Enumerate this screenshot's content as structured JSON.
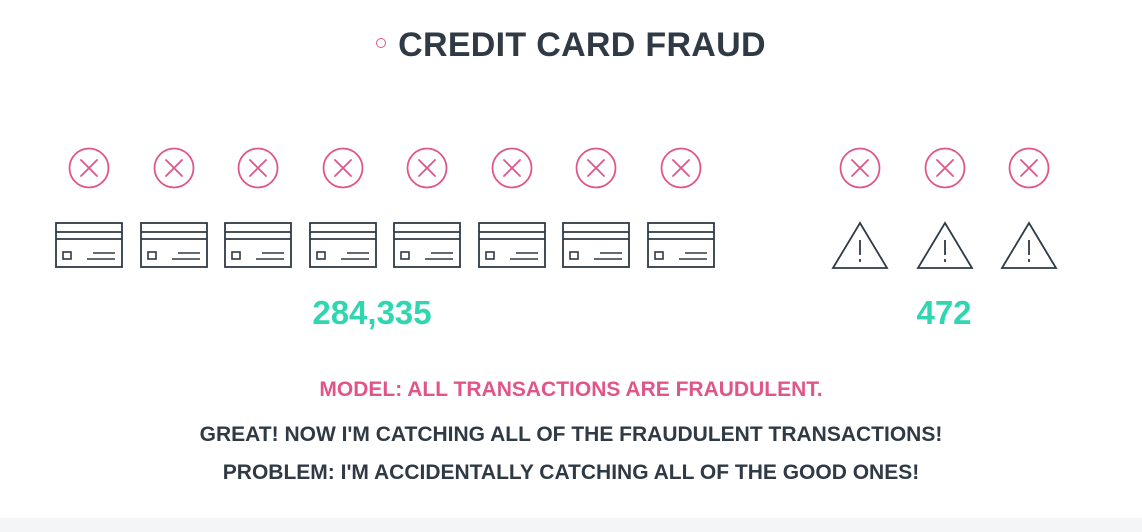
{
  "title": "CREDIT CARD FRAUD",
  "colors": {
    "accent_pink": "#e0558a",
    "accent_teal": "#2fd6b0",
    "text_dark": "#2f3a45"
  },
  "good_group": {
    "icon_count": 8,
    "card_icon": "credit-card-icon",
    "flag_icon": "x-circle-icon",
    "count": "284,335"
  },
  "fraud_group": {
    "icon_count": 3,
    "item_icon": "warning-triangle-icon",
    "flag_icon": "x-circle-icon",
    "count": "472"
  },
  "messages": {
    "model": "MODEL: ALL TRANSACTIONS ARE FRAUDULENT.",
    "great": "GREAT! NOW I'M CATCHING ALL OF THE FRAUDULENT TRANSACTIONS!",
    "problem": "PROBLEM: I'M ACCIDENTALLY CATCHING ALL OF THE GOOD ONES!"
  }
}
